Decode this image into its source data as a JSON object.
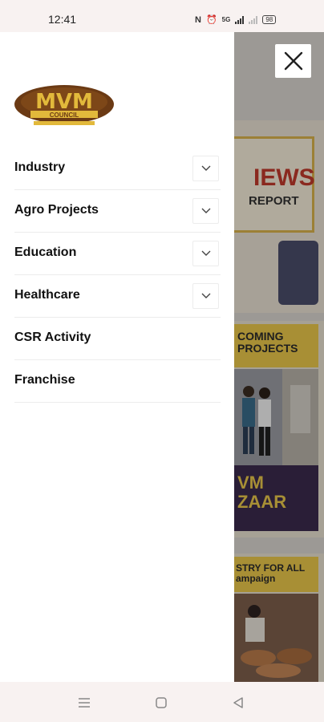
{
  "status_bar": {
    "time": "12:41",
    "nfc": "N",
    "alarm": "⏰",
    "network": "5G",
    "battery": "98"
  },
  "drawer": {
    "logo": {
      "name": "MVM",
      "subtitle": "COUNCIL"
    },
    "menu_items": [
      {
        "label": "Industry",
        "has_submenu": true
      },
      {
        "label": "Agro Projects",
        "has_submenu": true
      },
      {
        "label": "Education",
        "has_submenu": true
      },
      {
        "label": "Healthcare",
        "has_submenu": true
      },
      {
        "label": "CSR Activity",
        "has_submenu": false
      },
      {
        "label": "Franchise",
        "has_submenu": false
      }
    ]
  },
  "background": {
    "news_title": "IEWS",
    "news_sub": "REPORT",
    "upcoming_line1": "COMING",
    "upcoming_line2": "PROJECTS",
    "bazaar_line1": "VM",
    "bazaar_line2": "ZAAR",
    "industry_line1": "STRY FOR ALL",
    "industry_line2": "ampaign"
  },
  "colors": {
    "brand_brown": "#6b3a14",
    "brand_gold": "#e2b93b",
    "accent_yellow": "#e9c64a"
  }
}
